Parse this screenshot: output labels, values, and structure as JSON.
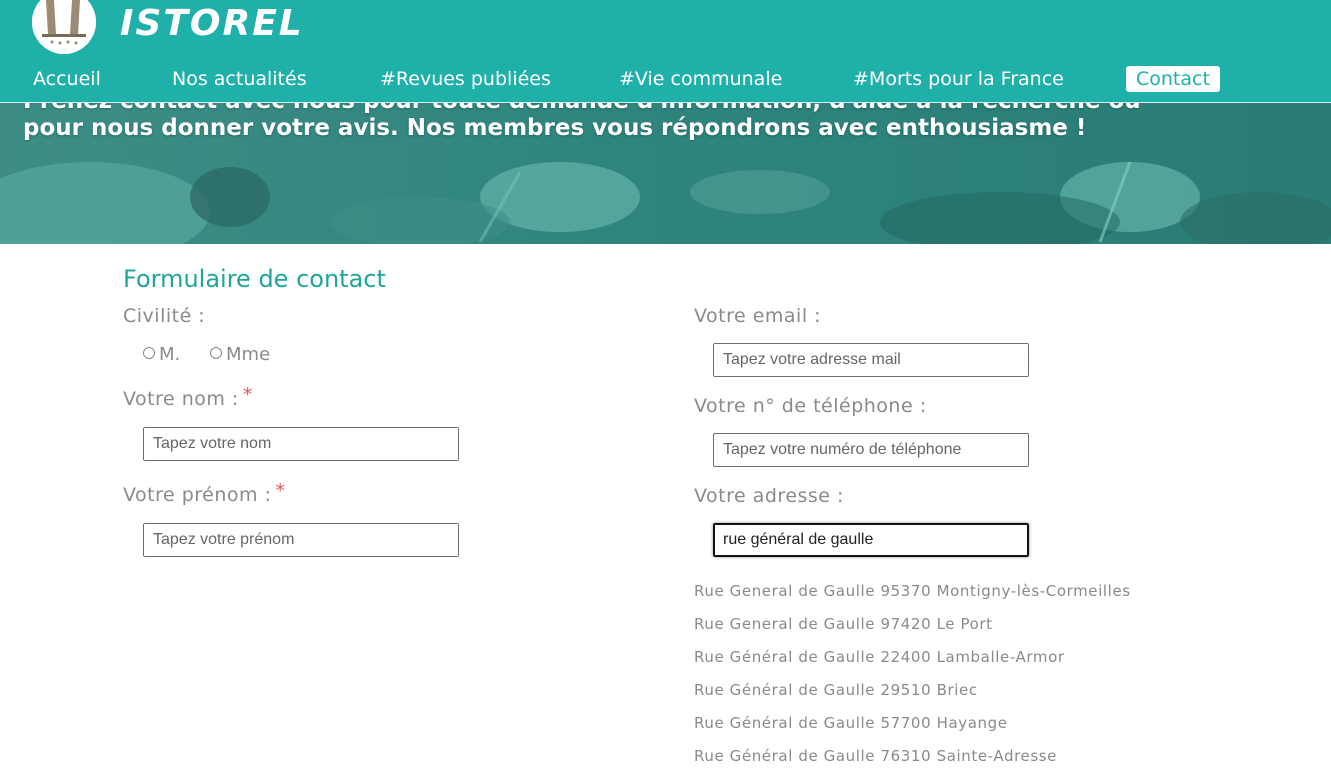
{
  "header": {
    "brand": "ISTOREL",
    "nav": [
      {
        "label": "Accueil"
      },
      {
        "label": "Nos actualités"
      },
      {
        "label": "#Revues publiées"
      },
      {
        "label": "#Vie communale"
      },
      {
        "label": "#Morts pour la France"
      },
      {
        "label": "Contact",
        "active": true
      }
    ]
  },
  "banner": {
    "text": "Prenez contact avec nous pour toute demande d'information, d'aide à la recherche ou pour nous donner votre avis. Nos membres vous répondrons avec enthousiasme !"
  },
  "form": {
    "title": "Formulaire de contact",
    "civility_label": "Civilité :",
    "civility_options": [
      "M.",
      "Mme"
    ],
    "name_label": "Votre nom :",
    "name_placeholder": "Tapez votre nom",
    "firstname_label": "Votre prénom :",
    "firstname_placeholder": "Tapez votre prénom",
    "required_mark": "*",
    "email_label": "Votre email :",
    "email_placeholder": "Tapez votre adresse mail",
    "phone_label": "Votre n° de téléphone :",
    "phone_placeholder": "Tapez votre numéro de téléphone",
    "address_label": "Votre adresse :",
    "address_value": "rue général de gaulle",
    "address_suggestions": [
      "Rue General de Gaulle 95370 Montigny-lès-Cormeilles",
      "Rue General de Gaulle 97420 Le Port",
      "Rue Général de Gaulle 22400 Lamballe-Armor",
      "Rue Général de Gaulle 29510 Briec",
      "Rue Général de Gaulle 57700 Hayange",
      "Rue Général de Gaulle 76310 Sainte-Adresse"
    ]
  },
  "colors": {
    "brand_teal": "#20b0aa",
    "title_teal": "#20a49e",
    "required_red": "#e05555",
    "label_gray": "#8a8a8a"
  }
}
